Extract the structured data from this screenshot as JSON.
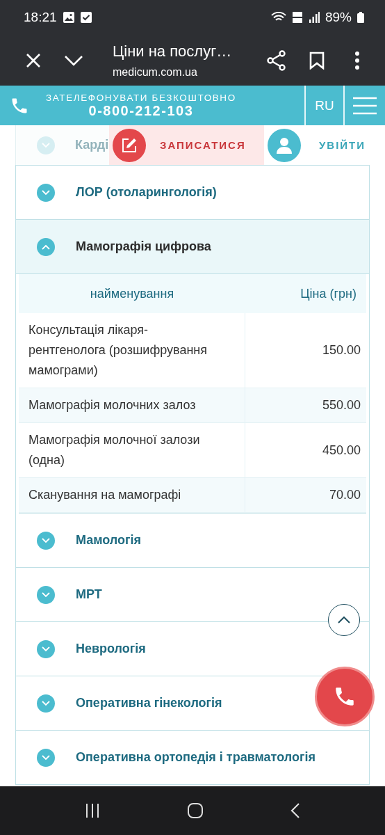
{
  "status_bar": {
    "time": "18:21",
    "battery": "89%"
  },
  "browser": {
    "title": "Ціни на послуг…",
    "url": "medicum.com.ua"
  },
  "header": {
    "call_label": "ЗАТЕЛЕФОНУВАТИ БЕЗКОШТОВНО",
    "phone": "0-800-212-103",
    "language": "RU"
  },
  "action_bar": {
    "behind_text": "Карді",
    "book": "ЗАПИСАТИСЯ",
    "login": "УВІЙТИ"
  },
  "sections": [
    {
      "title": "ЛОР (отоларингологія)",
      "expanded": false
    },
    {
      "title": "Мамографія цифрова",
      "expanded": true,
      "table": {
        "columns": [
          "найменування",
          "Ціна (грн)"
        ],
        "rows": [
          [
            "Консультація лікаря-рентгенолога (розшифрування мамограми)",
            "150.00"
          ],
          [
            "Мамографія молочних залоз",
            "550.00"
          ],
          [
            "Мамографія молочної залози (одна)",
            "450.00"
          ],
          [
            "Сканування на мамографі",
            "70.00"
          ]
        ]
      }
    },
    {
      "title": "Мамологія",
      "expanded": false
    },
    {
      "title": "МРТ",
      "expanded": false
    },
    {
      "title": "Неврологія",
      "expanded": false
    },
    {
      "title": "Оперативна гінекологія",
      "expanded": false
    },
    {
      "title": "Оперативна ортопедія і травматологія",
      "expanded": false
    }
  ]
}
